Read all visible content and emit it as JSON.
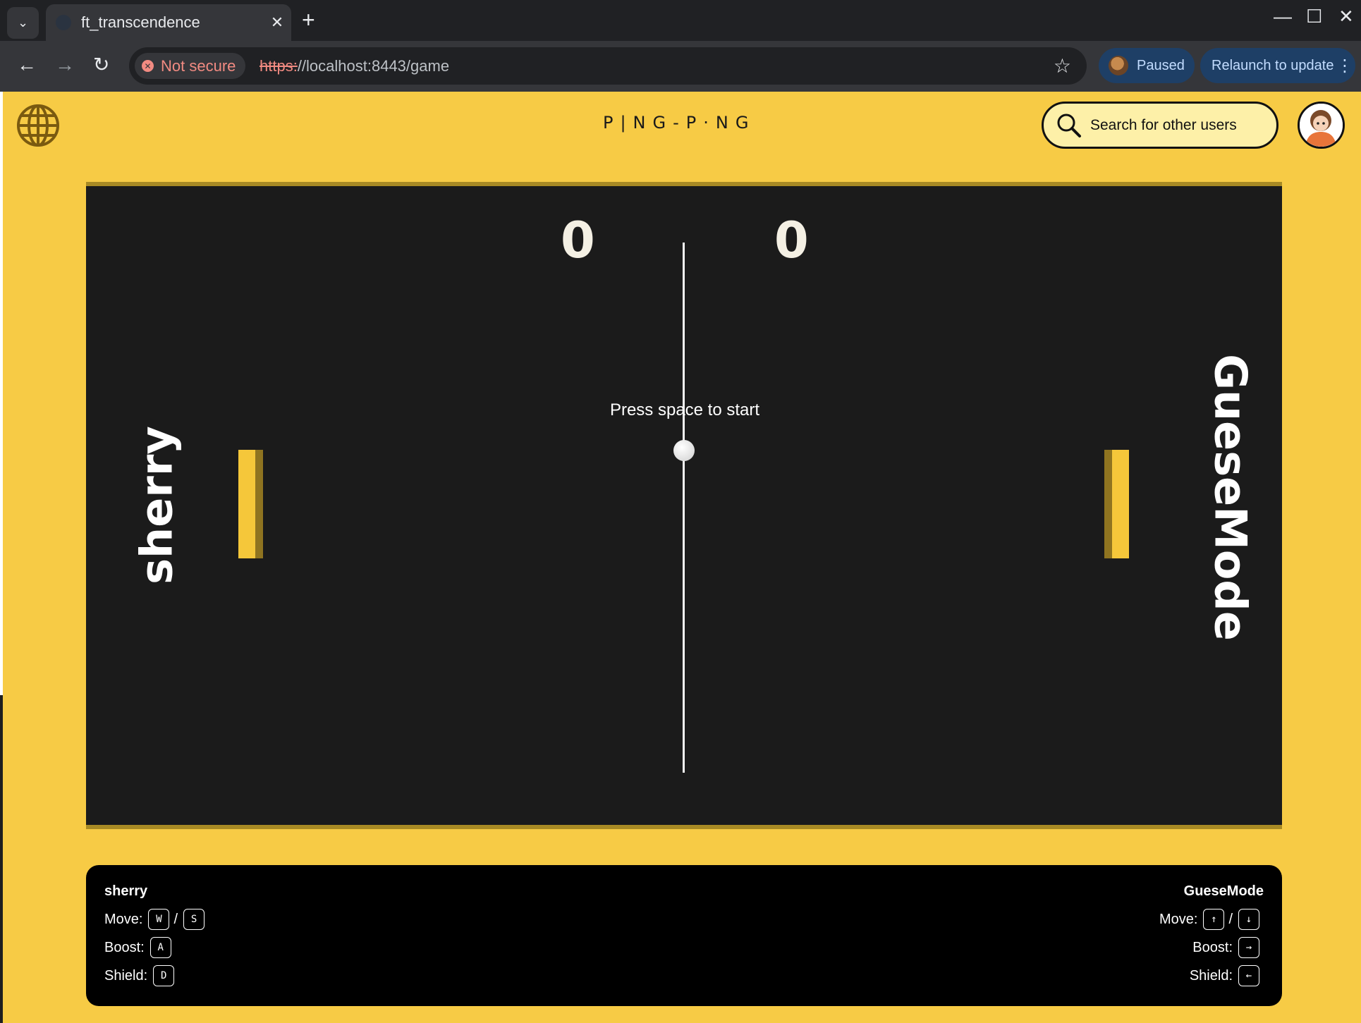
{
  "browser": {
    "tab_title": "ft_transcendence",
    "tab_close": "✕",
    "new_tab": "+",
    "security_label": "Not secure",
    "url_scheme": "https:",
    "url_rest": "//localhost:8443/game",
    "profile_status": "Paused",
    "relaunch_label": "Relaunch to update"
  },
  "header": {
    "logo": "P|NG-P·NG",
    "search_placeholder": "Search for other users"
  },
  "game": {
    "score_left": "0",
    "score_right": "0",
    "prompt": "Press space to start",
    "player_left": "sherry",
    "player_right": "GueseMode"
  },
  "controls": {
    "left": {
      "name": "sherry",
      "move_label": "Move:",
      "move_up": "W",
      "move_down": "S",
      "boost_label": "Boost:",
      "boost_key": "A",
      "shield_label": "Shield:",
      "shield_key": "D"
    },
    "right": {
      "name": "GueseMode",
      "move_label": "Move:",
      "move_up": "↑",
      "move_down": "↓",
      "boost_label": "Boost:",
      "boost_key": "→",
      "shield_label": "Shield:",
      "shield_key": "←"
    },
    "separator": "/"
  },
  "colors": {
    "page_bg": "#f7cb45",
    "game_bg": "#1b1b1b",
    "paddle": "#f5c73a"
  },
  "icons": {
    "globe": "globe-icon",
    "search": "search-icon",
    "avatar": "user-avatar"
  }
}
